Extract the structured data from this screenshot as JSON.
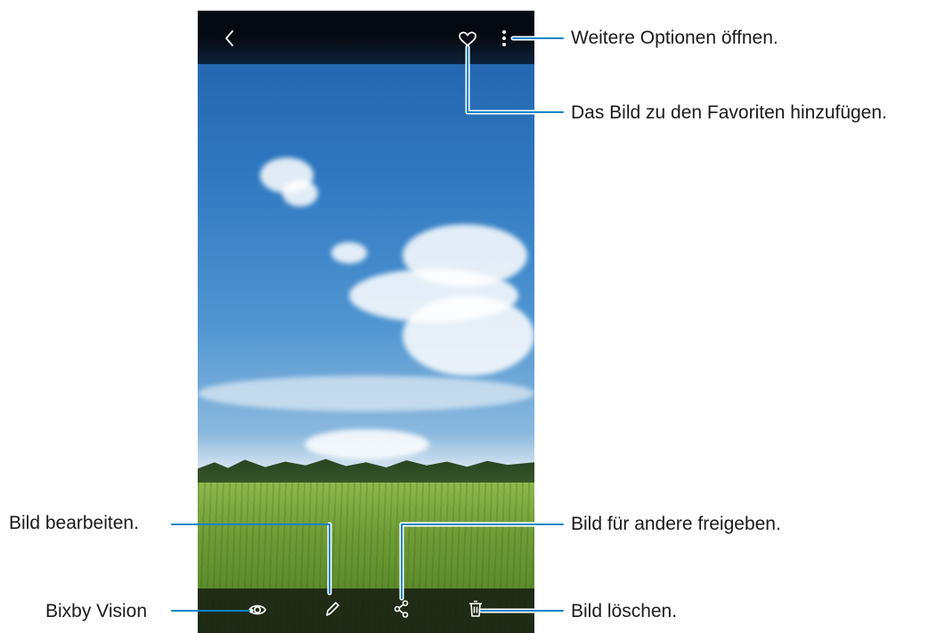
{
  "callouts": {
    "more_options": "Weitere Optionen öffnen.",
    "add_favorite": "Das Bild zu den Favoriten hinzufügen.",
    "edit_image": "Bild bearbeiten.",
    "share_image": "Bild für andere freigeben.",
    "bixby_vision": "Bixby Vision",
    "delete_image": "Bild löschen."
  },
  "toolbar": {
    "top_icons": [
      "back-icon",
      "heart-icon",
      "more-options-icon"
    ],
    "bottom_icons": [
      "bixby-vision-icon",
      "edit-icon",
      "share-icon",
      "delete-icon"
    ]
  },
  "colors": {
    "callout_line": "#0a86c8",
    "text": "#1a1a1a"
  }
}
